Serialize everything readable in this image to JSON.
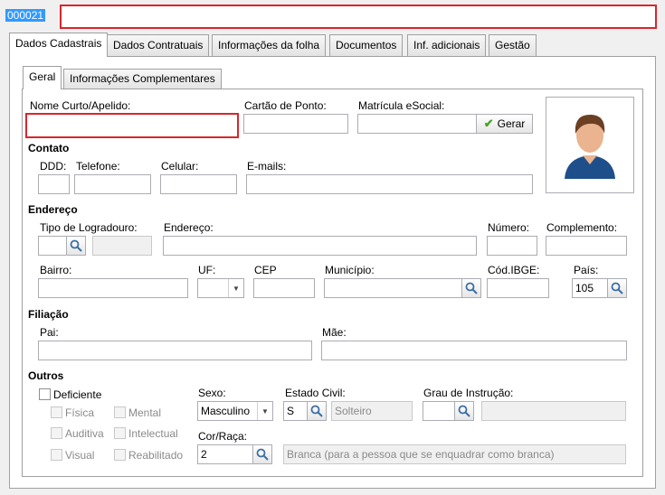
{
  "record": {
    "code": "000021",
    "name_value": ""
  },
  "tabs": [
    "Dados Cadastrais",
    "Dados Contratuais",
    "Informações da folha",
    "Documentos",
    "Inf. adicionais",
    "Gestão"
  ],
  "subtabs": [
    "Geral",
    "Informações Complementares"
  ],
  "labels": {
    "nome_curto": "Nome Curto/Apelido:",
    "cartao_ponto": "Cartão de Ponto:",
    "matricula_esocial": "Matrícula eSocial:",
    "gerar": "Gerar",
    "contato": "Contato",
    "ddd": "DDD:",
    "telefone": "Telefone:",
    "celular": "Celular:",
    "emails": "E-mails:",
    "endereco_sec": "Endereço",
    "tipo_logradouro": "Tipo de Logradouro:",
    "endereco": "Endereço:",
    "numero": "Número:",
    "complemento": "Complemento:",
    "bairro": "Bairro:",
    "uf": "UF:",
    "cep": "CEP",
    "municipio": "Município:",
    "cod_ibge": "Cód.IBGE:",
    "pais": "País:",
    "filiacao": "Filiação",
    "pai": "Pai:",
    "mae": "Mãe:",
    "outros": "Outros",
    "deficiente": "Deficiente",
    "fisica": "Física",
    "auditiva": "Auditiva",
    "visual": "Visual",
    "mental": "Mental",
    "intelectual": "Intelectual",
    "reabilitado": "Reabilitado",
    "sexo": "Sexo:",
    "estado_civil": "Estado Civil:",
    "grau_instrucao": "Grau de Instrução:",
    "cor_raca": "Cor/Raça:"
  },
  "values": {
    "pais": "105",
    "sexo": "Masculino",
    "estado_civil_code": "S",
    "estado_civil_desc": "Solteiro",
    "cor_raca_code": "2",
    "cor_raca_desc": "Branca (para a pessoa que se enquadrar como branca)"
  },
  "colors": {
    "highlight": "#d9262c",
    "selection": "#3399ff"
  }
}
